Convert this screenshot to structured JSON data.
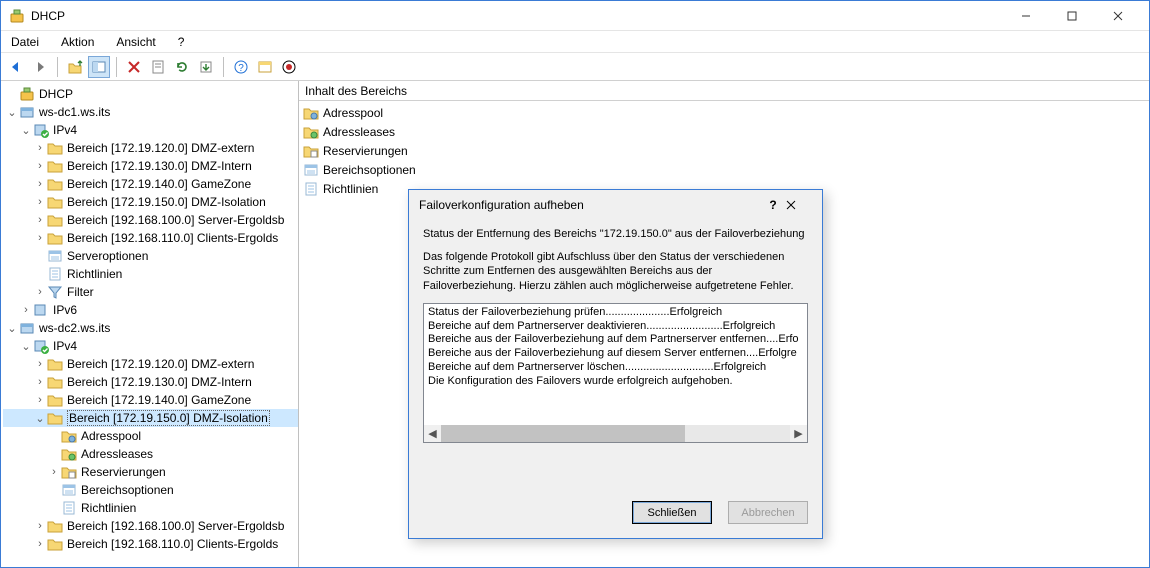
{
  "window": {
    "title": "DHCP"
  },
  "menu": {
    "items": [
      "Datei",
      "Aktion",
      "Ansicht",
      "?"
    ]
  },
  "toolbar": {
    "buttons": [
      {
        "name": "back-icon",
        "type": "arrow-left",
        "color": "#1e6fd6"
      },
      {
        "name": "forward-icon",
        "type": "arrow-right",
        "color": "#7a7a7a"
      },
      {
        "name": "sep"
      },
      {
        "name": "folder-up-icon",
        "type": "folder-up"
      },
      {
        "name": "panes-icon",
        "type": "panes",
        "active": true
      },
      {
        "name": "sep"
      },
      {
        "name": "delete-icon",
        "type": "x",
        "color": "#c62828"
      },
      {
        "name": "properties-icon",
        "type": "props"
      },
      {
        "name": "refresh-icon",
        "type": "refresh",
        "color": "#2e7d32"
      },
      {
        "name": "export-icon",
        "type": "export"
      },
      {
        "name": "sep"
      },
      {
        "name": "help-icon",
        "type": "help",
        "color": "#1e6fd6"
      },
      {
        "name": "options-icon",
        "type": "options"
      },
      {
        "name": "record-icon",
        "type": "record",
        "color": "#c62828"
      }
    ]
  },
  "tree": [
    {
      "depth": 0,
      "tw": "",
      "icon": "dhcp",
      "label": "DHCP"
    },
    {
      "depth": 0,
      "tw": "v",
      "icon": "server",
      "label": "ws-dc1.ws.its"
    },
    {
      "depth": 1,
      "tw": "v",
      "icon": "proto-ok",
      "label": "IPv4"
    },
    {
      "depth": 2,
      "tw": ">",
      "icon": "scope",
      "label": "Bereich [172.19.120.0] DMZ-extern"
    },
    {
      "depth": 2,
      "tw": ">",
      "icon": "scope",
      "label": "Bereich [172.19.130.0] DMZ-Intern"
    },
    {
      "depth": 2,
      "tw": ">",
      "icon": "scope",
      "label": "Bereich [172.19.140.0] GameZone"
    },
    {
      "depth": 2,
      "tw": ">",
      "icon": "scope",
      "label": "Bereich [172.19.150.0] DMZ-Isolation"
    },
    {
      "depth": 2,
      "tw": ">",
      "icon": "scope",
      "label": "Bereich [192.168.100.0] Server-Ergoldsb"
    },
    {
      "depth": 2,
      "tw": ">",
      "icon": "scope",
      "label": "Bereich [192.168.110.0] Clients-Ergolds"
    },
    {
      "depth": 2,
      "tw": "",
      "icon": "opts",
      "label": "Serveroptionen"
    },
    {
      "depth": 2,
      "tw": "",
      "icon": "policy",
      "label": "Richtlinien"
    },
    {
      "depth": 2,
      "tw": ">",
      "icon": "filter",
      "label": "Filter"
    },
    {
      "depth": 1,
      "tw": ">",
      "icon": "proto",
      "label": "IPv6"
    },
    {
      "depth": 0,
      "tw": "v",
      "icon": "server",
      "label": "ws-dc2.ws.its"
    },
    {
      "depth": 1,
      "tw": "v",
      "icon": "proto-ok",
      "label": "IPv4"
    },
    {
      "depth": 2,
      "tw": ">",
      "icon": "scope",
      "label": "Bereich [172.19.120.0] DMZ-extern"
    },
    {
      "depth": 2,
      "tw": ">",
      "icon": "scope",
      "label": "Bereich [172.19.130.0] DMZ-Intern"
    },
    {
      "depth": 2,
      "tw": ">",
      "icon": "scope",
      "label": "Bereich [172.19.140.0] GameZone"
    },
    {
      "depth": 2,
      "tw": "v",
      "icon": "scope",
      "label": "Bereich [172.19.150.0] DMZ-Isolation",
      "selected": true
    },
    {
      "depth": 3,
      "tw": "",
      "icon": "pool",
      "label": "Adresspool"
    },
    {
      "depth": 3,
      "tw": "",
      "icon": "leases",
      "label": "Adressleases"
    },
    {
      "depth": 3,
      "tw": ">",
      "icon": "res",
      "label": "Reservierungen"
    },
    {
      "depth": 3,
      "tw": "",
      "icon": "opts",
      "label": "Bereichsoptionen"
    },
    {
      "depth": 3,
      "tw": "",
      "icon": "policy",
      "label": "Richtlinien"
    },
    {
      "depth": 2,
      "tw": ">",
      "icon": "scope",
      "label": "Bereich [192.168.100.0] Server-Ergoldsb"
    },
    {
      "depth": 2,
      "tw": ">",
      "icon": "scope",
      "label": "Bereich [192.168.110.0] Clients-Ergolds"
    }
  ],
  "list": {
    "header": "Inhalt des Bereichs",
    "items": [
      {
        "icon": "pool",
        "label": "Adresspool"
      },
      {
        "icon": "leases",
        "label": "Adressleases"
      },
      {
        "icon": "res",
        "label": "Reservierungen"
      },
      {
        "icon": "opts",
        "label": "Bereichsoptionen"
      },
      {
        "icon": "policy",
        "label": "Richtlinien"
      }
    ]
  },
  "dialog": {
    "title": "Failoverkonfiguration aufheben",
    "status_line": "Status der Entfernung des Bereichs \"172.19.150.0\" aus der Failoverbeziehung",
    "info_line": "Das folgende Protokoll gibt Aufschluss über den Status der verschiedenen Schritte zum Entfernen des ausgewählten Bereichs aus der Failoverbeziehung. Hierzu zählen auch möglicherweise aufgetretene Fehler.",
    "log": [
      "Status der Failoverbeziehung prüfen.....................Erfolgreich",
      "Bereiche auf dem Partnerserver deaktivieren.........................Erfolgreich",
      "Bereiche aus der Failoverbeziehung auf dem Partnerserver entfernen....Erfo",
      "Bereiche aus der Failoverbeziehung auf diesem Server entfernen....Erfolgre",
      "Bereiche auf dem Partnerserver löschen.............................Erfolgreich",
      "Die Konfiguration des Failovers wurde erfolgreich aufgehoben."
    ],
    "btn_close": "Schließen",
    "btn_cancel": "Abbrechen"
  }
}
